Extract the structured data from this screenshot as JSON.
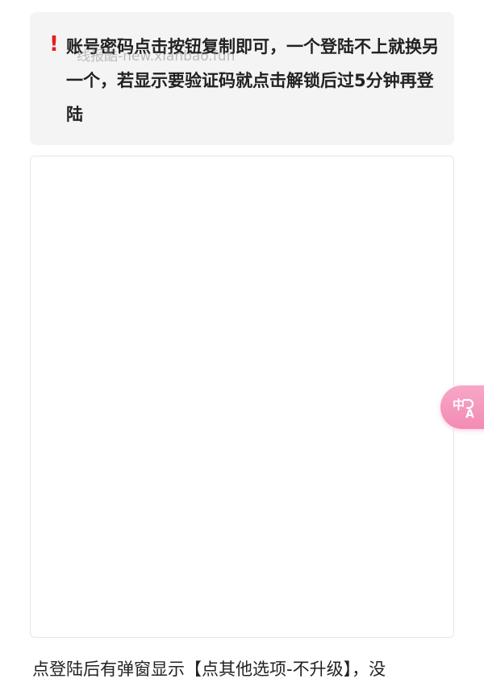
{
  "notice": {
    "icon": "exclamation-icon",
    "text": "账号密码点击按钮复制即可，一个登陆不上就换另一个，若显示要验证码就点击解锁后过5分钟再登陆",
    "watermark": "线报酷-new.xianbao.fun"
  },
  "translate_button": {
    "icon": "translate-icon"
  },
  "footer": {
    "text": "点登陆后有弹窗显示【点其他选项-不升级】，没"
  },
  "colors": {
    "alert": "#e02020",
    "fab": "#f38bb4"
  }
}
